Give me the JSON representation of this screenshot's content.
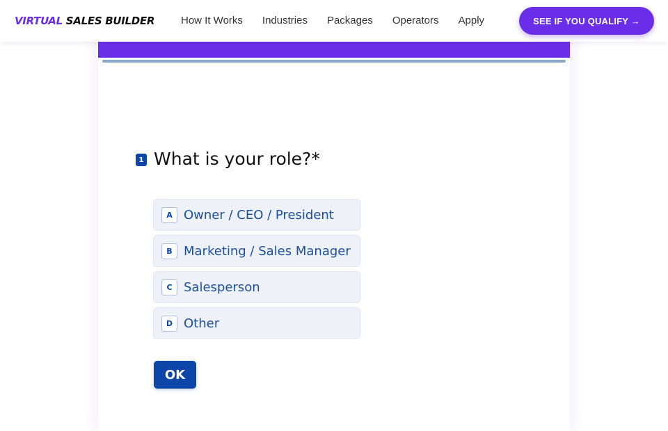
{
  "brand": {
    "logo_accent": "VIRTUAL",
    "logo_rest": " SALES BUILDER",
    "accent_color": "#6a2ee8"
  },
  "nav": {
    "links": [
      "How It Works",
      "Industries",
      "Packages",
      "Operators",
      "Apply"
    ],
    "cta_label": "SEE IF YOU QUALIFY →"
  },
  "form": {
    "question_number": "1",
    "question": "What is your role?*",
    "options": [
      {
        "key": "A",
        "label": "Owner / CEO / President"
      },
      {
        "key": "B",
        "label": "Marketing / Sales Manager"
      },
      {
        "key": "C",
        "label": "Salesperson"
      },
      {
        "key": "D",
        "label": "Other"
      }
    ],
    "submit_label": "OK",
    "button_color": "#0c46a8"
  }
}
